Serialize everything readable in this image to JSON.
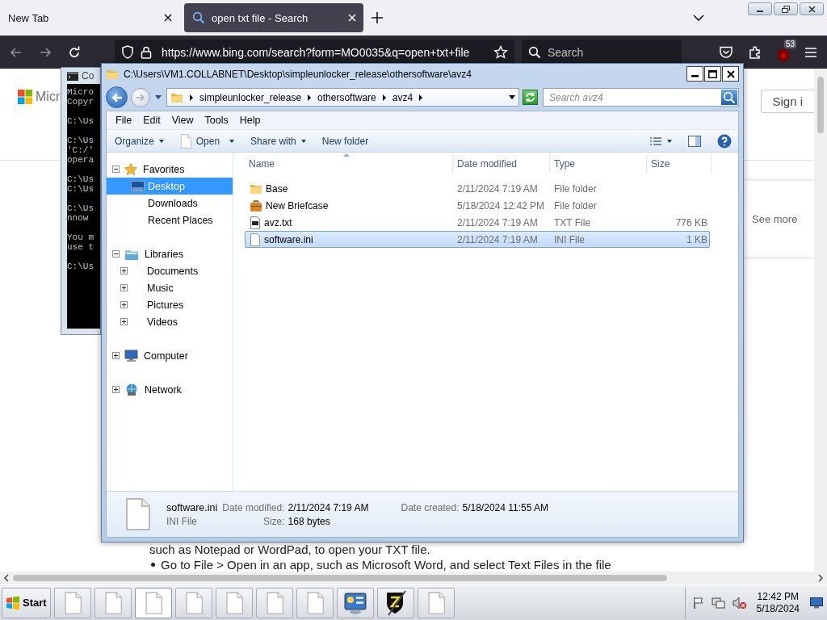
{
  "browser": {
    "tabs": [
      {
        "label": "New Tab",
        "selected": false
      },
      {
        "label": "open txt file - Search",
        "selected": true
      }
    ],
    "url": "https://www.bing.com/search?form=MO0035&q=open+txt+file",
    "search_placeholder": "Search",
    "extension_badge": "53",
    "page": {
      "logo_text": "Micr",
      "sign_in": "Sign i",
      "see_more": "See more",
      "paragraphs": [
        {
          "kind": "continuation",
          "text": "such as Notepad or WordPad, to open your TXT file."
        },
        {
          "kind": "bullet",
          "text": "Go to File > Open in an app, such as Microsoft Word, and select Text Files in the file"
        }
      ]
    }
  },
  "console": {
    "title": "Co",
    "blocks": [
      [
        "Micro",
        "Copyr"
      ],
      [
        "C:\\Us"
      ],
      [
        "C:\\Us",
        "'C:/'",
        "opera"
      ],
      [
        "C:\\Us",
        "C:\\Us"
      ],
      [
        "C:\\Us",
        "nnow"
      ],
      [
        "You m",
        "use t"
      ],
      [
        "C:\\Us"
      ]
    ]
  },
  "explorer": {
    "title": "C:\\Users\\VM1.COLLABNET\\Desktop\\simpleunlocker_release\\othersoftware\\avz4",
    "breadcrumb": [
      "simpleunlocker_release",
      "othersoftware",
      "avz4"
    ],
    "search_placeholder": "Search avz4",
    "menu": [
      "File",
      "Edit",
      "View",
      "Tools",
      "Help"
    ],
    "commands": [
      {
        "label": "Organize",
        "kind": "menu"
      },
      {
        "label": "Open",
        "kind": "split"
      },
      {
        "label": "Share with",
        "kind": "menu"
      },
      {
        "label": "New folder",
        "kind": "plain"
      }
    ],
    "nav": [
      {
        "label": "Favorites",
        "kind": "favorites",
        "expanded": true,
        "selected": false,
        "children": [
          {
            "label": "Desktop",
            "kind": "desktop",
            "selected": true
          },
          {
            "label": "Downloads",
            "kind": "plain",
            "selected": false
          },
          {
            "label": "Recent Places",
            "kind": "plain",
            "selected": false
          }
        ]
      },
      {
        "label": "Libraries",
        "kind": "libraries",
        "expanded": true,
        "selected": false,
        "children": [
          {
            "label": "Documents",
            "kind": "library",
            "expanded": false,
            "selected": false
          },
          {
            "label": "Music",
            "kind": "library",
            "expanded": false,
            "selected": false
          },
          {
            "label": "Pictures",
            "kind": "library",
            "expanded": false,
            "selected": false
          },
          {
            "label": "Videos",
            "kind": "library",
            "expanded": false,
            "selected": false
          }
        ]
      },
      {
        "label": "Computer",
        "kind": "computer",
        "expanded": false,
        "selected": false
      },
      {
        "label": "Network",
        "kind": "network",
        "expanded": false,
        "selected": false
      }
    ],
    "columns": [
      "Name",
      "Date modified",
      "Type",
      "Size"
    ],
    "files": [
      {
        "name": "Base",
        "modified": "2/11/2024 7:19 AM",
        "type": "File folder",
        "kind": "folder",
        "selected": false
      },
      {
        "name": "New Briefcase",
        "modified": "5/18/2024 12:42 PM",
        "type": "File folder",
        "kind": "briefcase",
        "selected": false
      },
      {
        "name": "avz.txt",
        "modified": "2/11/2024 7:19 AM",
        "type": "TXT File",
        "size": "776 KB",
        "kind": "text",
        "selected": false
      },
      {
        "name": "software.ini",
        "modified": "2/11/2024 7:19 AM",
        "type": "INI File",
        "size": "1 KB",
        "kind": "ini",
        "selected": true
      }
    ],
    "details": {
      "name": "software.ini",
      "type": "INI File",
      "properties": [
        [
          {
            "label": "Date modified:",
            "value": "2/11/2024 7:19 AM"
          },
          {
            "label": "Size:",
            "value": "168 bytes"
          }
        ],
        [
          {
            "label": "Date created:",
            "value": "5/18/2024 11:55 AM"
          }
        ]
      ]
    }
  },
  "taskbar": {
    "start": "Start",
    "buttons": [
      {
        "kind": "document",
        "selected": false
      },
      {
        "kind": "document",
        "selected": false
      },
      {
        "kind": "document",
        "selected": true
      },
      {
        "kind": "document",
        "selected": false
      },
      {
        "kind": "document",
        "selected": false
      },
      {
        "kind": "document",
        "selected": false
      },
      {
        "kind": "document",
        "selected": false
      },
      {
        "kind": "control-panel",
        "selected": false
      },
      {
        "kind": "shield",
        "selected": false
      },
      {
        "kind": "document",
        "selected": false
      }
    ],
    "time": "12:42 PM",
    "date": "5/18/2024"
  }
}
